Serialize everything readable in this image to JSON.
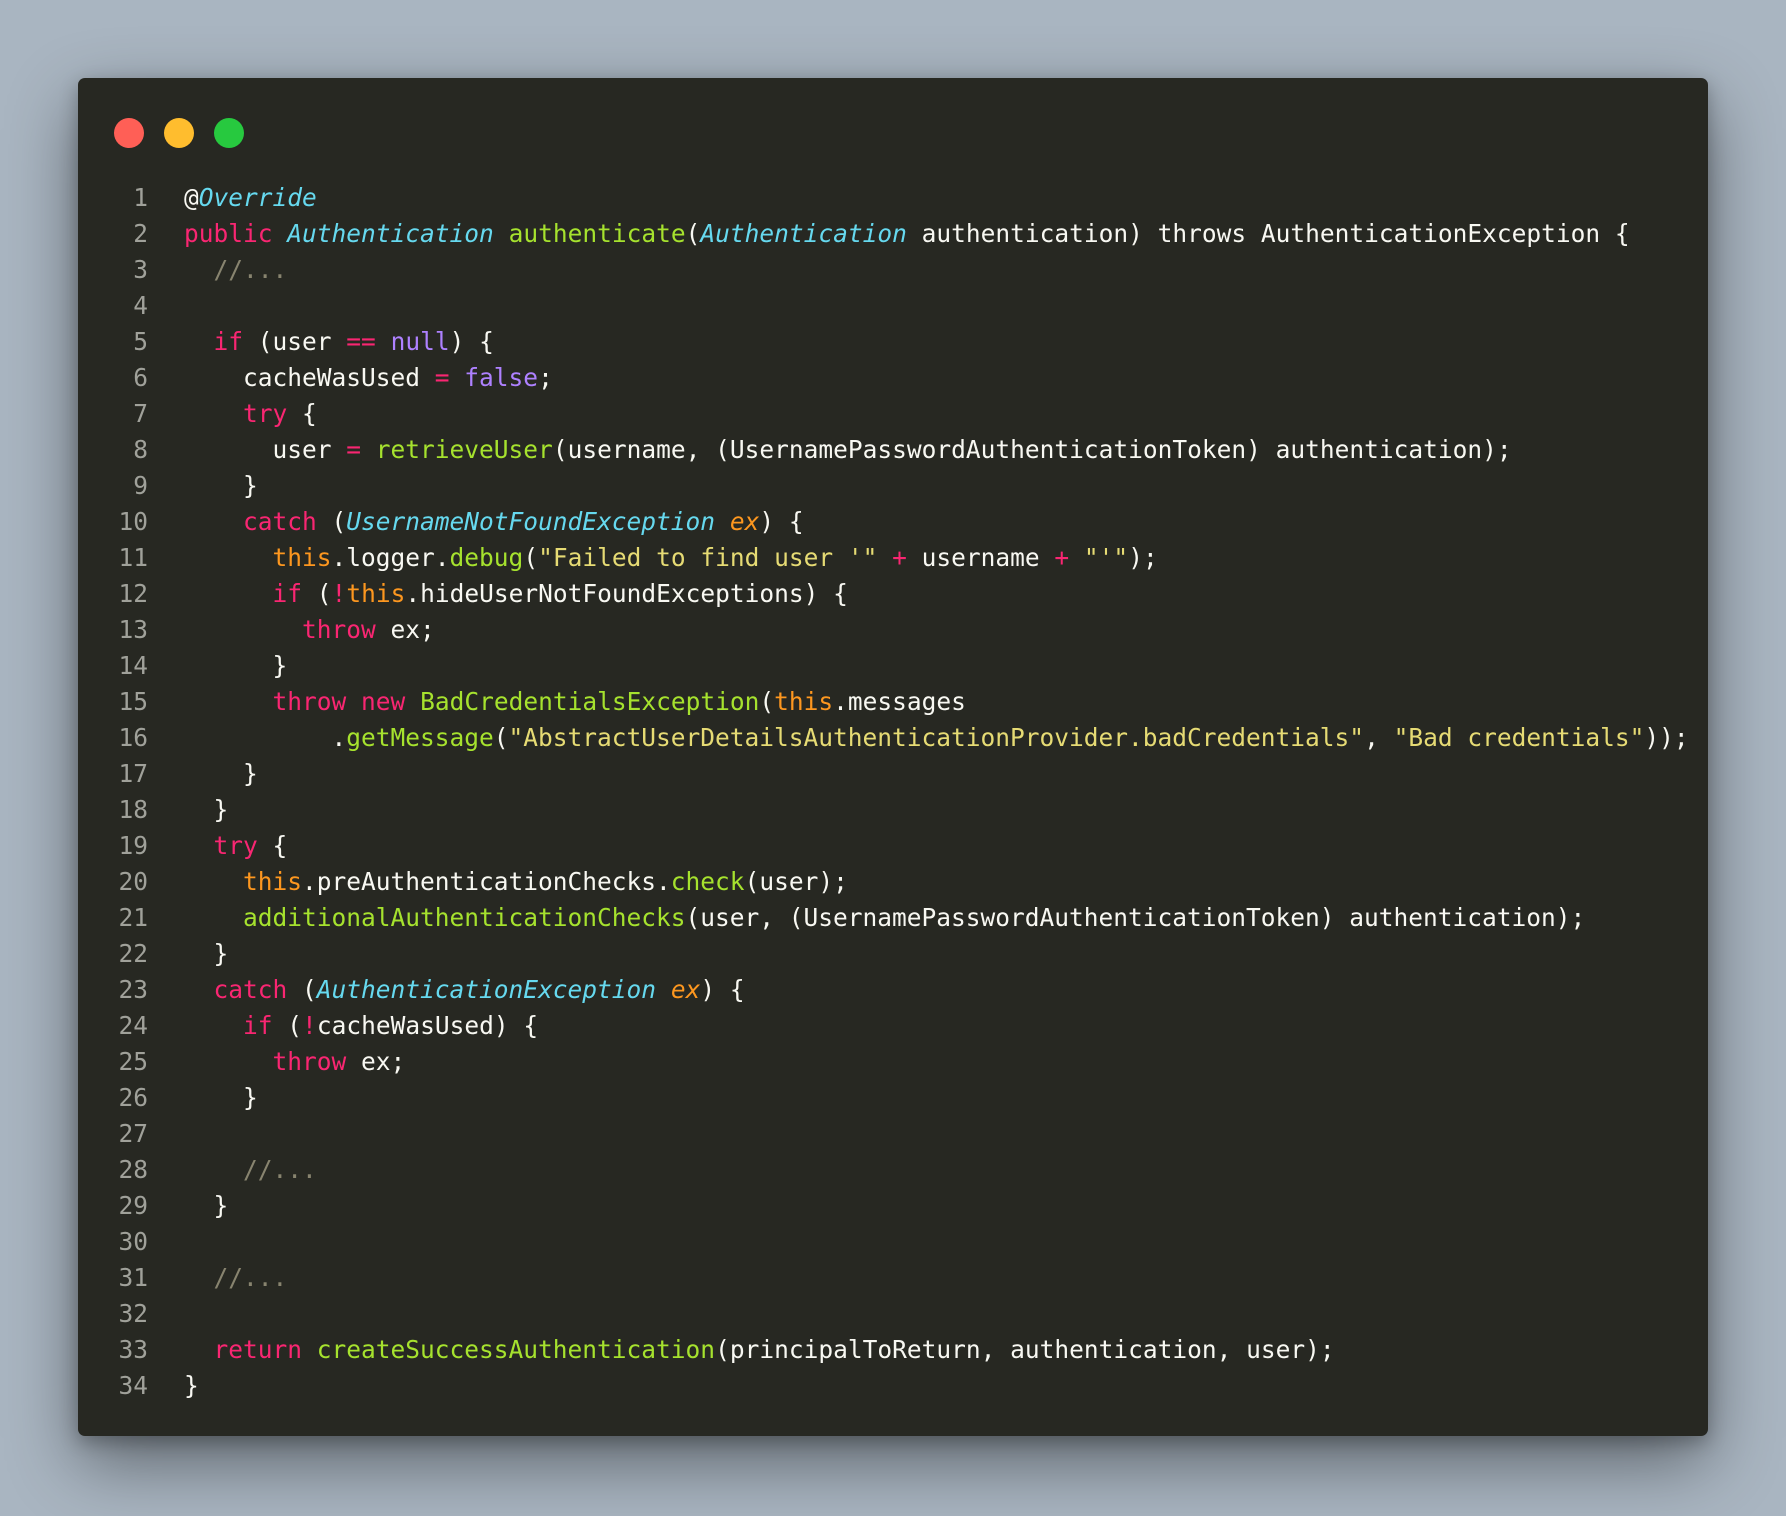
{
  "window": {
    "buttons": [
      "close",
      "minimize",
      "maximize"
    ]
  },
  "code": {
    "lines": [
      [
        [
          "txt",
          "@"
        ],
        [
          "ann",
          "Override"
        ]
      ],
      [
        [
          "kw",
          "public"
        ],
        [
          "txt",
          " "
        ],
        [
          "typ",
          "Authentication"
        ],
        [
          "txt",
          " "
        ],
        [
          "fn",
          "authenticate"
        ],
        [
          "txt",
          "("
        ],
        [
          "typ",
          "Authentication"
        ],
        [
          "txt",
          " authentication) throws AuthenticationException {"
        ]
      ],
      [
        [
          "txt",
          "  "
        ],
        [
          "cm",
          "//..."
        ]
      ],
      [],
      [
        [
          "txt",
          "  "
        ],
        [
          "kw",
          "if"
        ],
        [
          "txt",
          " (user "
        ],
        [
          "op",
          "=="
        ],
        [
          "txt",
          " "
        ],
        [
          "cst",
          "null"
        ],
        [
          "txt",
          ") {"
        ]
      ],
      [
        [
          "txt",
          "    cacheWasUsed "
        ],
        [
          "op",
          "="
        ],
        [
          "txt",
          " "
        ],
        [
          "cst",
          "false"
        ],
        [
          "txt",
          ";"
        ]
      ],
      [
        [
          "txt",
          "    "
        ],
        [
          "kw",
          "try"
        ],
        [
          "txt",
          " {"
        ]
      ],
      [
        [
          "txt",
          "      user "
        ],
        [
          "op",
          "="
        ],
        [
          "txt",
          " "
        ],
        [
          "fn",
          "retrieveUser"
        ],
        [
          "txt",
          "(username, (UsernamePasswordAuthenticationToken) authentication);"
        ]
      ],
      [
        [
          "txt",
          "    }"
        ]
      ],
      [
        [
          "txt",
          "    "
        ],
        [
          "kw",
          "catch"
        ],
        [
          "txt",
          " ("
        ],
        [
          "typ",
          "UsernameNotFoundException"
        ],
        [
          "txt",
          " "
        ],
        [
          "par",
          "ex"
        ],
        [
          "txt",
          ") {"
        ]
      ],
      [
        [
          "txt",
          "      "
        ],
        [
          "ths",
          "this"
        ],
        [
          "txt",
          ".logger."
        ],
        [
          "fn",
          "debug"
        ],
        [
          "txt",
          "("
        ],
        [
          "str",
          "\"Failed to find user '\""
        ],
        [
          "txt",
          " "
        ],
        [
          "op",
          "+"
        ],
        [
          "txt",
          " username "
        ],
        [
          "op",
          "+"
        ],
        [
          "txt",
          " "
        ],
        [
          "str",
          "\"'\""
        ],
        [
          "txt",
          ");"
        ]
      ],
      [
        [
          "txt",
          "      "
        ],
        [
          "kw",
          "if"
        ],
        [
          "txt",
          " ("
        ],
        [
          "op",
          "!"
        ],
        [
          "ths",
          "this"
        ],
        [
          "txt",
          ".hideUserNotFoundExceptions) {"
        ]
      ],
      [
        [
          "txt",
          "        "
        ],
        [
          "kw",
          "throw"
        ],
        [
          "txt",
          " ex;"
        ]
      ],
      [
        [
          "txt",
          "      }"
        ]
      ],
      [
        [
          "txt",
          "      "
        ],
        [
          "kw",
          "throw"
        ],
        [
          "txt",
          " "
        ],
        [
          "kw",
          "new"
        ],
        [
          "txt",
          " "
        ],
        [
          "cls",
          "BadCredentialsException"
        ],
        [
          "txt",
          "("
        ],
        [
          "ths",
          "this"
        ],
        [
          "txt",
          ".messages"
        ]
      ],
      [
        [
          "txt",
          "          ."
        ],
        [
          "fn",
          "getMessage"
        ],
        [
          "txt",
          "("
        ],
        [
          "str",
          "\"AbstractUserDetailsAuthenticationProvider.badCredentials\""
        ],
        [
          "txt",
          ", "
        ],
        [
          "str",
          "\"Bad credentials\""
        ],
        [
          "txt",
          "));"
        ]
      ],
      [
        [
          "txt",
          "    }"
        ]
      ],
      [
        [
          "txt",
          "  }"
        ]
      ],
      [
        [
          "txt",
          "  "
        ],
        [
          "kw",
          "try"
        ],
        [
          "txt",
          " {"
        ]
      ],
      [
        [
          "txt",
          "    "
        ],
        [
          "ths",
          "this"
        ],
        [
          "txt",
          ".preAuthenticationChecks."
        ],
        [
          "fn",
          "check"
        ],
        [
          "txt",
          "(user);"
        ]
      ],
      [
        [
          "txt",
          "    "
        ],
        [
          "fn",
          "additionalAuthenticationChecks"
        ],
        [
          "txt",
          "(user, (UsernamePasswordAuthenticationToken) authentication);"
        ]
      ],
      [
        [
          "txt",
          "  }"
        ]
      ],
      [
        [
          "txt",
          "  "
        ],
        [
          "kw",
          "catch"
        ],
        [
          "txt",
          " ("
        ],
        [
          "typ",
          "AuthenticationException"
        ],
        [
          "txt",
          " "
        ],
        [
          "par",
          "ex"
        ],
        [
          "txt",
          ") {"
        ]
      ],
      [
        [
          "txt",
          "    "
        ],
        [
          "kw",
          "if"
        ],
        [
          "txt",
          " ("
        ],
        [
          "op",
          "!"
        ],
        [
          "txt",
          "cacheWasUsed) {"
        ]
      ],
      [
        [
          "txt",
          "      "
        ],
        [
          "kw",
          "throw"
        ],
        [
          "txt",
          " ex;"
        ]
      ],
      [
        [
          "txt",
          "    }"
        ]
      ],
      [],
      [
        [
          "txt",
          "    "
        ],
        [
          "cm",
          "//..."
        ]
      ],
      [
        [
          "txt",
          "  }"
        ]
      ],
      [],
      [
        [
          "txt",
          "  "
        ],
        [
          "cm",
          "//..."
        ]
      ],
      [],
      [
        [
          "txt",
          "  "
        ],
        [
          "kw",
          "return"
        ],
        [
          "txt",
          " "
        ],
        [
          "fn",
          "createSuccessAuthentication"
        ],
        [
          "txt",
          "(principalToReturn, authentication, user);"
        ]
      ],
      [
        [
          "txt",
          "}"
        ]
      ]
    ]
  },
  "colors": {
    "background": "#a9b5c1",
    "window": "#272822",
    "close": "#ff5f56",
    "minimize": "#ffbd2e",
    "maximize": "#27c93f",
    "keyword": "#f92672",
    "type": "#66d9ef",
    "function": "#a6e22e",
    "string": "#e6db74",
    "comment": "#88846f",
    "constant": "#ae81ff",
    "this": "#fd971f"
  }
}
